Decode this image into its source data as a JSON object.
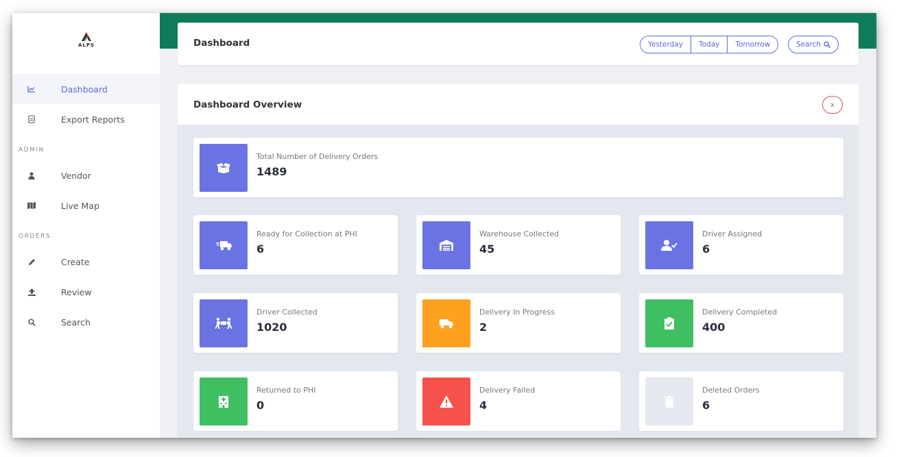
{
  "brand": {
    "logo_text": "ALPS"
  },
  "sidebar": {
    "items": [
      {
        "label": "Dashboard",
        "icon": "chart-line-icon"
      },
      {
        "label": "Export Reports",
        "icon": "file-export-icon"
      }
    ],
    "admin_label": "ADMIN",
    "admin_items": [
      {
        "label": "Vendor",
        "icon": "user-icon"
      },
      {
        "label": "Live Map",
        "icon": "map-icon"
      }
    ],
    "orders_label": "ORDERS",
    "orders_items": [
      {
        "label": "Create",
        "icon": "pencil-icon"
      },
      {
        "label": "Review",
        "icon": "upload-icon"
      },
      {
        "label": "Search",
        "icon": "search-icon"
      }
    ]
  },
  "header": {
    "title": "Dashboard",
    "date_buttons": [
      "Yesterday",
      "Today",
      "Tomorrow"
    ],
    "search_label": "Search"
  },
  "overview": {
    "title": "Dashboard Overview",
    "close_label": "x"
  },
  "stats": {
    "total": {
      "label": "Total Number of Delivery Orders",
      "value": "1489",
      "icon": "box-open-icon",
      "color": "#6973e3"
    },
    "cards": [
      {
        "label": "Ready for Collection at PHI",
        "value": "6",
        "icon": "shipping-fast-icon",
        "color": "#6973e3"
      },
      {
        "label": "Warehouse Collected",
        "value": "45",
        "icon": "warehouse-icon",
        "color": "#6973e3"
      },
      {
        "label": "Driver Assigned",
        "value": "6",
        "icon": "user-check-icon",
        "color": "#6973e3"
      },
      {
        "label": "Driver Collected",
        "value": "1020",
        "icon": "people-carry-icon",
        "color": "#6973e3"
      },
      {
        "label": "Delivery In Progress",
        "value": "2",
        "icon": "truck-icon",
        "color": "#ffa021"
      },
      {
        "label": "Delivery Completed",
        "value": "400",
        "icon": "clipboard-check-icon",
        "color": "#3fbf62"
      },
      {
        "label": "Returned to PHI",
        "value": "0",
        "icon": "hospital-icon",
        "color": "#3fbf62"
      },
      {
        "label": "Delivery Failed",
        "value": "4",
        "icon": "warning-icon",
        "color": "#f6524b"
      },
      {
        "label": "Deleted Orders",
        "value": "6",
        "icon": "trash-icon",
        "color": "#e5e8ef"
      }
    ]
  }
}
